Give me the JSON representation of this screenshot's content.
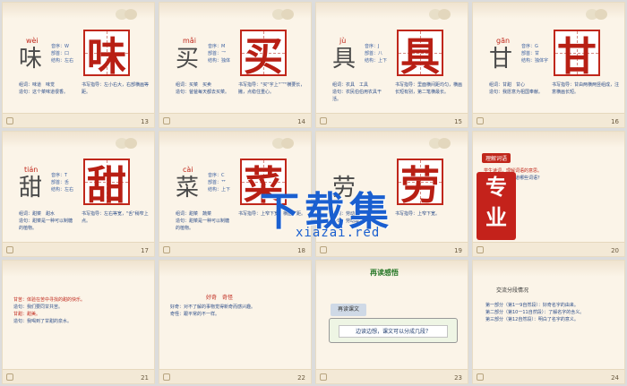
{
  "watermark": {
    "text": "下载集",
    "url": "xiazai.red",
    "seal": "专业"
  },
  "slides": [
    {
      "num": "13",
      "pinyin": "wèi",
      "char": "味",
      "meta": [
        "音序：W",
        "部首：口",
        "结构：左右"
      ],
      "words": [
        "组词：味道　味觉",
        "造句：这个菜味道很香。"
      ],
      "tip": "书写指导：左小右大，右部横画等距。"
    },
    {
      "num": "14",
      "pinyin": "mǎi",
      "char": "买",
      "meta": [
        "音序：M",
        "部首：乛",
        "结构：独体"
      ],
      "words": [
        "组词：买菜　买卖",
        "造句：爸爸每天都去买菜。"
      ],
      "tip": "书写指导：\"买\"字上\"乛\"横要长，撇，点稳住重心。"
    },
    {
      "num": "15",
      "pinyin": "jù",
      "char": "具",
      "meta": [
        "音序：J",
        "部首：八",
        "结构：上下"
      ],
      "words": [
        "组词：农具　工具",
        "造句：农民伯伯用农具干活。"
      ],
      "tip": "书写指导：里面横间距均匀，横画长短有别，第二笔横最长。"
    },
    {
      "num": "16",
      "pinyin": "gān",
      "char": "甘",
      "meta": [
        "音序：G",
        "部首：甘",
        "结构：独体字"
      ],
      "words": [
        "组词：甘甜　甘心",
        "造句：我愿意为祖国奉献。"
      ],
      "tip": "书写指导：甘由两横两竖组成，注意横画长短。"
    },
    {
      "num": "17",
      "pinyin": "tián",
      "char": "甜",
      "meta": [
        "音序：T",
        "部首：舌",
        "结构：左右"
      ],
      "words": [
        "组词：甜菜　甜水",
        "造句：甜菜是一种可以制糖的植物。"
      ],
      "tip": "书写指导：左右等宽，\"舌\"稍窄上点。"
    },
    {
      "num": "18",
      "pinyin": "cài",
      "char": "菜",
      "meta": [
        "音序：C",
        "部首：艹",
        "结构：上下"
      ],
      "words": [
        "组词：甜菜　蔬菜",
        "造句：甜菜是一种可以制糖的植物。"
      ],
      "tip": "书写指导：上窄下宽，横画等距。"
    },
    {
      "num": "19",
      "char": "劳",
      "words": [
        "组词：劳动",
        "造句：劳动最光荣。"
      ],
      "tip": "书写指导：上窄下宽。"
    },
    {
      "num": "20",
      "header": "理解词语",
      "lines": [
        "学生读词，理解词语的意思。",
        "说一说：你还知道哪些词语？"
      ]
    },
    {
      "num": "21",
      "lines": [
        "甘苦：体验在苦中寻找的甜的快乐。",
        "造句：我们要同甘共苦。",
        "甘甜：甜美。",
        "造句：我喝到了甘甜的泉水。"
      ]
    },
    {
      "num": "22",
      "header": "好奇　奇怪",
      "lines": [
        "好奇：对不了解的事物觉得新奇而感兴趣。",
        "奇怪：跟平常的不一样。"
      ]
    },
    {
      "num": "23",
      "header": "再读感悟",
      "box_title": "再读课文",
      "question": "边读边想，课文可以分成几段？"
    },
    {
      "num": "24",
      "header": "交流分段情况",
      "lines": [
        "第一部分（第1一9自然段）：好奇名字的由来。",
        "第二部分（第10一11自然段）：了解名字的含义。",
        "第三部分（第12自然段）：明白了名字的意义。"
      ]
    }
  ]
}
